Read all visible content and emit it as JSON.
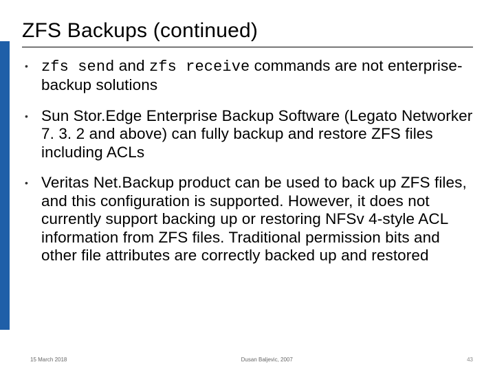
{
  "title": "ZFS Backups (continued)",
  "bullets": [
    {
      "pre_code1": "zfs send",
      "mid1": " and ",
      "pre_code2": "zfs receive",
      "tail": " commands are not enterprise-backup solutions"
    },
    {
      "text": "Sun Stor.Edge Enterprise Backup Software (Legato Networker 7. 3. 2 and above) can fully backup and restore ZFS files including ACLs"
    },
    {
      "text": "Veritas Net.Backup product can be used to back up ZFS files, and this configuration is supported. However, it does not currently support backing up or restoring NFSv 4-style ACL information from ZFS files. Traditional permission bits and other file attributes are correctly backed up and restored"
    }
  ],
  "footer": {
    "date": "15 March 2018",
    "author": "Dusan Baljevic, 2007",
    "page": "43"
  }
}
